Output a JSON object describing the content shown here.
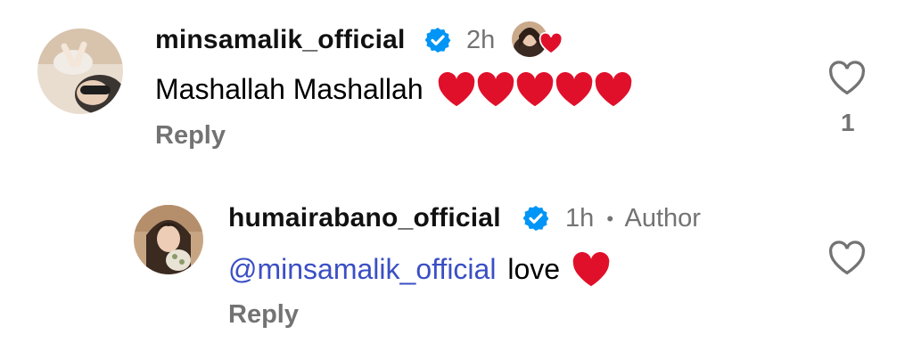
{
  "colors": {
    "verified": "#0095f6",
    "mention": "#3b4fc4",
    "secondary_text": "#737373",
    "heart": "#e0102b"
  },
  "comments": [
    {
      "username": "minsamalik_official",
      "time": "2h",
      "text": "Mashallah Mashallah",
      "emoji": "red-heart x5",
      "reply_label": "Reply",
      "like_count": "1",
      "liked_by_author_icon": "author-avatar-heart-icon"
    },
    {
      "username": "humairabano_official",
      "time": "1h",
      "separator": "•",
      "author_badge": "Author",
      "mention": "@minsamalik_official",
      "text": "love",
      "emoji": "red-heart",
      "reply_label": "Reply"
    }
  ]
}
